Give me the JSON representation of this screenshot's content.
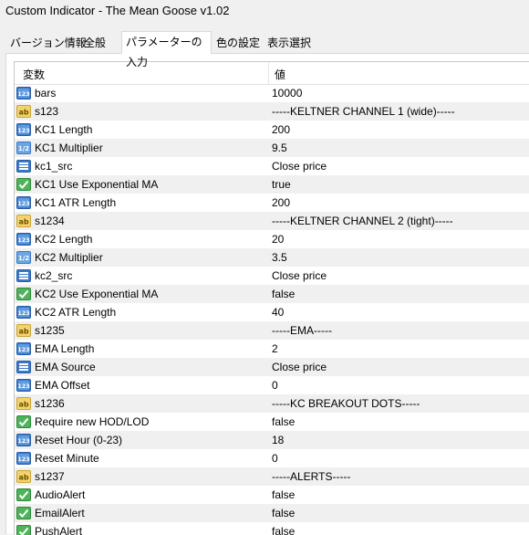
{
  "window": {
    "title": "Custom Indicator - The Mean Goose v1.02"
  },
  "tabs": [
    {
      "label": "バージョン情報"
    },
    {
      "label": "全般"
    },
    {
      "label": "パラメーターの入力",
      "active": true
    },
    {
      "label": "色の設定"
    },
    {
      "label": "表示選択"
    }
  ],
  "table": {
    "headers": {
      "variable": "変数",
      "value": "値"
    },
    "rows": [
      {
        "name": "bars",
        "value": "10000",
        "icon": "int-icon"
      },
      {
        "name": "s123",
        "value": "-----KELTNER CHANNEL 1  (wide)-----",
        "icon": "string-icon"
      },
      {
        "name": "KC1 Length",
        "value": "200",
        "icon": "int-icon"
      },
      {
        "name": "KC1 Multiplier",
        "value": "9.5",
        "icon": "double-icon"
      },
      {
        "name": "kc1_src",
        "value": "Close price",
        "icon": "enum-icon"
      },
      {
        "name": "KC1 Use Exponential MA",
        "value": "true",
        "icon": "bool-icon"
      },
      {
        "name": "KC1 ATR Length",
        "value": "200",
        "icon": "int-icon"
      },
      {
        "name": "s1234",
        "value": "-----KELTNER CHANNEL 2  (tight)-----",
        "icon": "string-icon"
      },
      {
        "name": "KC2 Length",
        "value": "20",
        "icon": "int-icon"
      },
      {
        "name": "KC2 Multiplier",
        "value": "3.5",
        "icon": "double-icon"
      },
      {
        "name": "kc2_src",
        "value": "Close price",
        "icon": "enum-icon"
      },
      {
        "name": "KC2 Use Exponential MA",
        "value": "false",
        "icon": "bool-icon"
      },
      {
        "name": "KC2 ATR Length",
        "value": "40",
        "icon": "int-icon"
      },
      {
        "name": "s1235",
        "value": "-----EMA-----",
        "icon": "string-icon"
      },
      {
        "name": "EMA Length",
        "value": "2",
        "icon": "int-icon"
      },
      {
        "name": "EMA Source",
        "value": "Close price",
        "icon": "enum-icon"
      },
      {
        "name": "EMA Offset",
        "value": "0",
        "icon": "int-icon"
      },
      {
        "name": "s1236",
        "value": "-----KC BREAKOUT DOTS-----",
        "icon": "string-icon"
      },
      {
        "name": "Require new HOD/LOD",
        "value": "false",
        "icon": "bool-icon"
      },
      {
        "name": "Reset Hour (0-23)",
        "value": "18",
        "icon": "int-icon"
      },
      {
        "name": "Reset Minute",
        "value": "0",
        "icon": "int-icon"
      },
      {
        "name": "s1237",
        "value": "-----ALERTS-----",
        "icon": "string-icon"
      },
      {
        "name": "AudioAlert",
        "value": "false",
        "icon": "bool-icon"
      },
      {
        "name": "EmailAlert",
        "value": "false",
        "icon": "bool-icon"
      },
      {
        "name": "PushAlert",
        "value": "false",
        "icon": "bool-icon"
      }
    ]
  },
  "icon_labels": {
    "int": "123",
    "double": "1/2",
    "string": "ab"
  }
}
